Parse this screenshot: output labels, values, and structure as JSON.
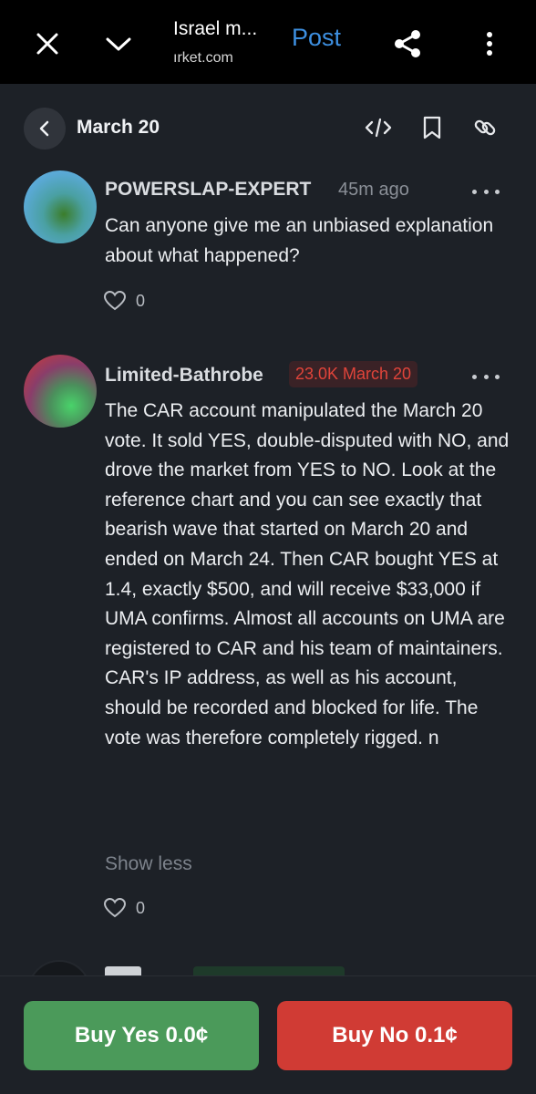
{
  "browser": {
    "title": "Israel m...",
    "url": "ırket.com",
    "action_label": "Post"
  },
  "header": {
    "title": "March 20"
  },
  "comments": [
    {
      "author": "POWERSLAP-EXPERT",
      "time": "45m ago",
      "text": "Can anyone give me an unbiased explanation about what happened?",
      "likes": "0"
    },
    {
      "author": "Limited-Bathrobe",
      "badge": "23.0K March 20",
      "text": "The CAR account manipulated the March 20 vote. It sold YES, double-disputed with NO, and drove the market from YES to NO. Look at the reference chart and you can see exactly that bearish wave that started on March 20 and ended on March 24. Then CAR bought YES at 1.4, exactly $500, and will receive $33,000 if UMA confirms. Almost all accounts on UMA are registered to CAR and his team of maintainers. CAR's IP address, as well as his account, should be recorded and blocked for life. The vote was therefore completely rigged. n",
      "show_less": "Show less",
      "likes": "0"
    }
  ],
  "actions": {
    "buy_yes": "Buy Yes 0.0¢",
    "buy_no": "Buy No 0.1¢"
  },
  "colors": {
    "background": "#1d2127",
    "accent_blue": "#3d8fe0",
    "yes_green": "#4b9a5a",
    "no_red": "#d03b34",
    "badge_red": "#e0443a"
  },
  "icons": [
    "close-icon",
    "chevron-down-icon",
    "share-icon",
    "kebab-menu-icon",
    "back-arrow-icon",
    "embed-code-icon",
    "bookmark-icon",
    "link-icon",
    "heart-icon",
    "more-options-icon"
  ]
}
